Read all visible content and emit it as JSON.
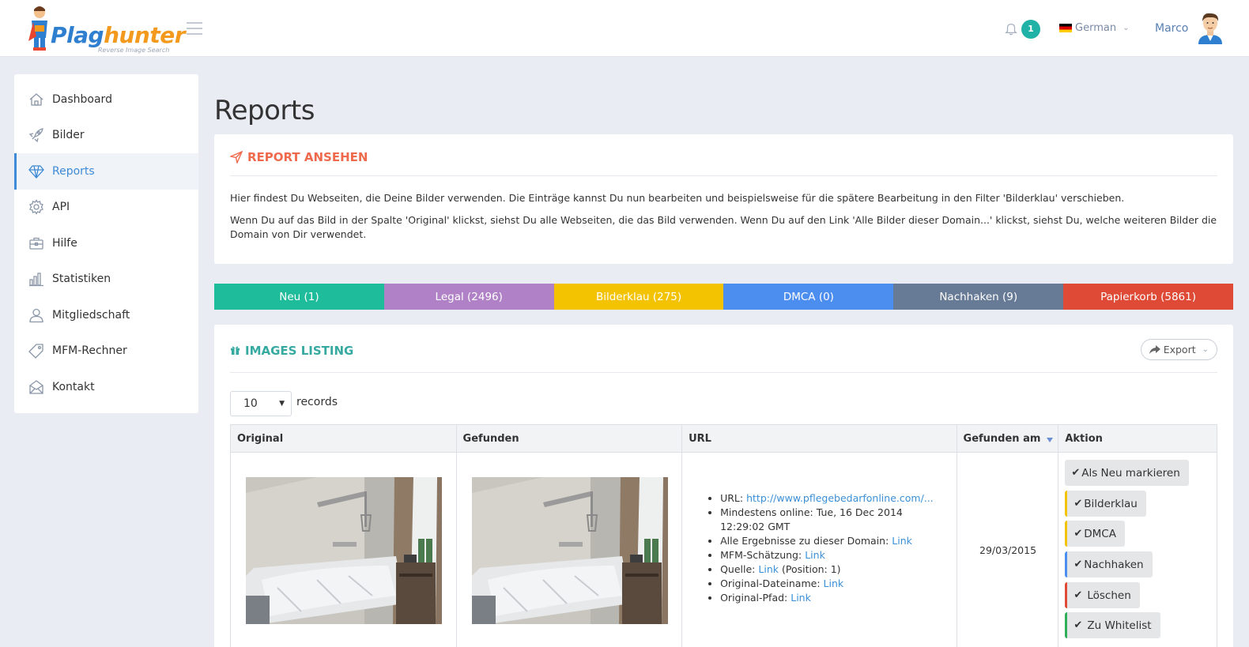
{
  "header": {
    "logo_text_1": "Plag",
    "logo_text_2": "hunter",
    "logo_subtitle": "Reverse Image Search",
    "notification_count": "1",
    "language": "German",
    "user_name": "Marco"
  },
  "sidebar": {
    "items": [
      {
        "label": "Dashboard",
        "icon": "home-icon"
      },
      {
        "label": "Bilder",
        "icon": "rocket-icon"
      },
      {
        "label": "Reports",
        "icon": "diamond-icon"
      },
      {
        "label": "API",
        "icon": "gear-icon"
      },
      {
        "label": "Hilfe",
        "icon": "briefcase-icon"
      },
      {
        "label": "Statistiken",
        "icon": "bar-chart-icon"
      },
      {
        "label": "Mitgliedschaft",
        "icon": "user-icon"
      },
      {
        "label": "MFM-Rechner",
        "icon": "tag-icon"
      },
      {
        "label": "Kontakt",
        "icon": "envelope-icon"
      }
    ]
  },
  "page": {
    "title": "Reports"
  },
  "report": {
    "heading": "REPORT ANSEHEN",
    "para1": "Hier findest Du Webseiten, die Deine Bilder verwenden. Die Einträge kannst Du nun bearbeiten und beispielsweise für die spätere Bearbeitung in den Filter 'Bilderklau' verschieben.",
    "para2": "Wenn Du auf das Bild in der Spalte 'Original' klickst, siehst Du alle Webseiten, die das Bild verwenden. Wenn Du auf den Link 'Alle Bilder dieser Domain...' klickst, siehst Du, welche weiteren Bilder die Domain von Dir verwendet."
  },
  "status_tabs": [
    {
      "label": "Neu (1)",
      "color": "#1fbc9c"
    },
    {
      "label": "Legal (2496)",
      "color": "#b081c6"
    },
    {
      "label": "Bilderklau (275)",
      "color": "#f3c200"
    },
    {
      "label": "DMCA (0)",
      "color": "#4c8df0"
    },
    {
      "label": "Nachhaken (9)",
      "color": "#677a96"
    },
    {
      "label": "Papierkorb (5861)",
      "color": "#de4a35"
    }
  ],
  "listing": {
    "heading": "IMAGES LISTING",
    "export_label": "Export",
    "records_value": "10",
    "records_label": "records",
    "columns": [
      "Original",
      "Gefunden",
      "URL",
      "Gefunden am",
      "Aktion"
    ],
    "row": {
      "url_label": "URL:",
      "url_link": "http://www.pflegebedarfonline.com/...",
      "online_text": "Mindestens online: Tue, 16 Dec 2014 12:29:02 GMT",
      "domain_label": "Alle Ergebnisse zu dieser Domain:",
      "mfm_label": "MFM-Schätzung:",
      "quelle_label": "Quelle:",
      "quelle_suffix": "(Position: 1)",
      "dateiname_label": "Original-Dateiname:",
      "pfad_label": "Original-Pfad:",
      "link_text": "Link",
      "date": "29/03/2015"
    },
    "actions": [
      {
        "label": "Als Neu markieren",
        "accent": ""
      },
      {
        "label": "Bilderklau",
        "accent": "#f3c200"
      },
      {
        "label": "DMCA",
        "accent": "#f3c200"
      },
      {
        "label": "Nachhaken",
        "accent": "#4c8df0"
      },
      {
        "label": "Löschen",
        "accent": "#de4a35"
      },
      {
        "label": "Zu Whitelist",
        "accent": "#2fae5a"
      }
    ]
  }
}
